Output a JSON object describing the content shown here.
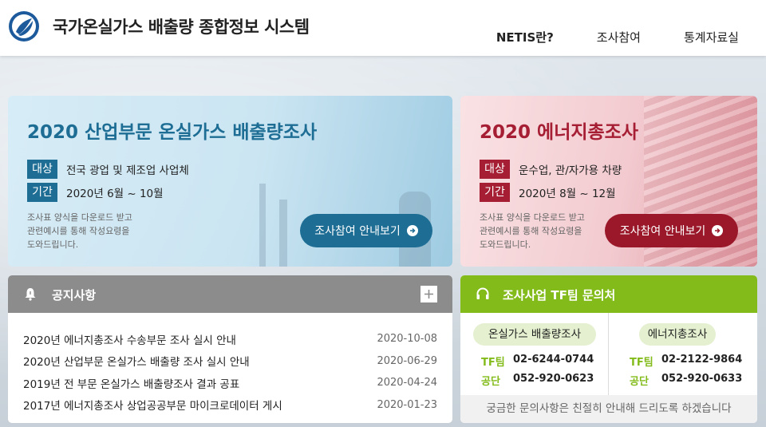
{
  "header": {
    "site_title": "국가온실가스 배출량 종합정보 시스템",
    "nav": [
      {
        "label": "NETIS란?"
      },
      {
        "label": "조사참여"
      },
      {
        "label": "통계자료실"
      }
    ]
  },
  "surveys": [
    {
      "year": "2020",
      "title": "산업부문 온실가스 배출량조사",
      "target_tag": "대상",
      "target": "전국 광업 및 제조업 사업체",
      "period_tag": "기간",
      "period": "2020년 6월 ~ 10월",
      "desc_lines": [
        "조사표 양식을 다운로드 받고",
        "관련예시를 통해 작성요령을",
        "도와드립니다."
      ],
      "button": "조사참여 안내보기",
      "color": "#1d6d94"
    },
    {
      "year": "2020",
      "title": "에너지총조사",
      "target_tag": "대상",
      "target": "운수업, 관/자가용 차량",
      "period_tag": "기간",
      "period": "2020년 8월 ~ 12월",
      "desc_lines": [
        "조사표 양식을 다운로드 받고",
        "관련예시를 통해 작성요령을",
        "도와드립니다."
      ],
      "button": "조사참여 안내보기",
      "color": "#a61e33"
    }
  ],
  "notice": {
    "title": "공지사항",
    "items": [
      {
        "title": "2020년 에너지총조사 수송부문 조사 실시 안내",
        "date": "2020-10-08"
      },
      {
        "title": "2020년 산업부문 온실가스 배출량 조사 실시 안내",
        "date": "2020-06-29"
      },
      {
        "title": "2019년 전 부문 온실가스 배출량조사 결과 공표",
        "date": "2020-04-24"
      },
      {
        "title": "2017년 에너지총조사 상업공공부문 마이크로데이터 게시",
        "date": "2020-01-23"
      }
    ]
  },
  "contact": {
    "title": "조사사업 TF팀 문의처",
    "groups": [
      {
        "name": "온실가스 배출량조사",
        "tf_label": "TF팀",
        "tf_phone": "02-6244-0744",
        "agency_label": "공단",
        "agency_phone": "052-920-0623"
      },
      {
        "name": "에너지총조사",
        "tf_label": "TF팀",
        "tf_phone": "02-2122-9864",
        "agency_label": "공단",
        "agency_phone": "052-920-0633"
      }
    ],
    "footer": "궁금한 문의사항은 친절히 안내해 드리도록 하겠습니다"
  },
  "colors": {
    "blue_accent": "#1d6d94",
    "red_accent": "#a61e33",
    "green_accent": "#82bb1a",
    "notice_header": "#8c8c8c"
  },
  "icons": [
    "logo-emblem",
    "bell-icon",
    "plus-icon",
    "headset-icon",
    "arrow-right-icon"
  ]
}
